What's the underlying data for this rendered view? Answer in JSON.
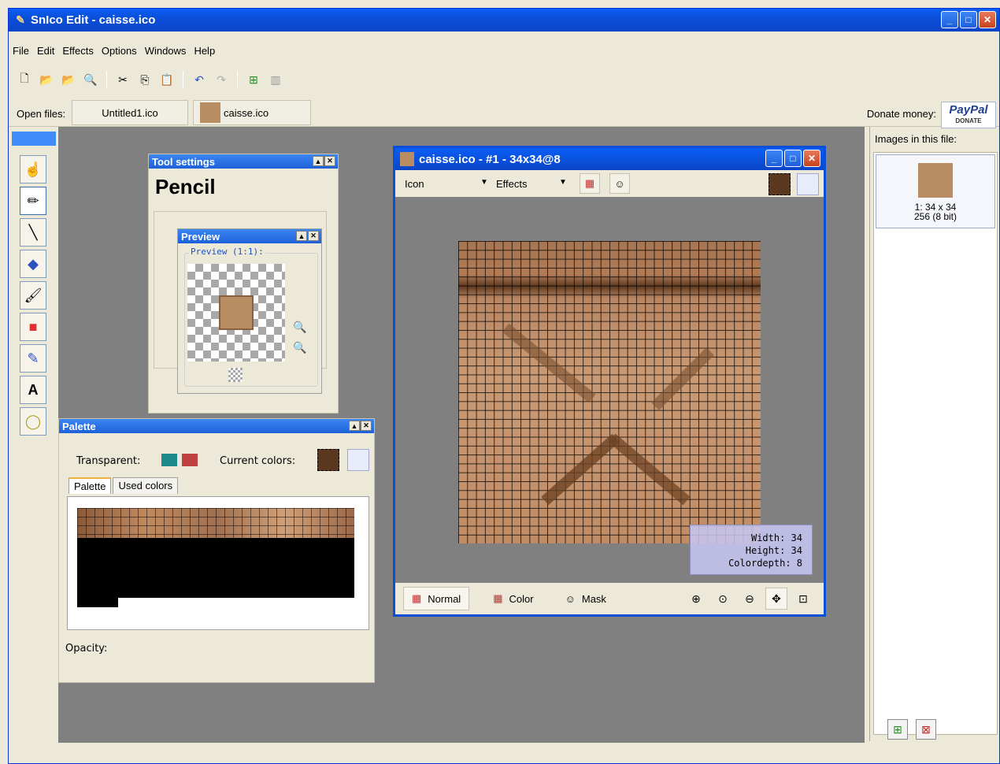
{
  "app": {
    "title": "SnIco Edit - caisse.ico"
  },
  "menu": [
    "File",
    "Edit",
    "Effects",
    "Options",
    "Windows",
    "Help"
  ],
  "toolbar": [
    "new-icon",
    "open-icon",
    "open-folder-icon",
    "properties-icon",
    "cut-icon",
    "copy-icon",
    "paste-icon",
    "undo-icon",
    "redo-icon",
    "add-image-icon",
    "delete-icon"
  ],
  "open_files": {
    "label": "Open files:",
    "tabs": [
      "Untitled1.ico",
      "caisse.ico"
    ]
  },
  "donate": {
    "label": "Donate money:",
    "paypal": "PayPal",
    "paypal_sub": "DONATE"
  },
  "images_panel": {
    "title": "Images in this file:",
    "item_line1": "1: 34 x 34",
    "item_line2": "256 (8 bit)"
  },
  "tool_settings": {
    "title": "Tool settings",
    "tool_name": "Pencil"
  },
  "preview": {
    "title": "Preview",
    "group_label": "Preview (1:1):"
  },
  "palette": {
    "title": "Palette",
    "transparent_label": "Transparent:",
    "current_colors_label": "Current colors:",
    "tabs": [
      "Palette",
      "Used colors"
    ],
    "opacity_label": "Opacity:"
  },
  "icon_window": {
    "title": "caisse.ico - #1 - 34x34@8",
    "mode_select": "Icon",
    "effects_select": "Effects",
    "info": {
      "width": "Width: 34",
      "height": "Height: 34",
      "colordepth": "Colordepth: 8"
    },
    "modes": [
      "Normal",
      "Color",
      "Mask"
    ]
  },
  "colors": {
    "accent": "#0a4fd8",
    "workspace": "#808080",
    "crate": "#b88d62"
  }
}
